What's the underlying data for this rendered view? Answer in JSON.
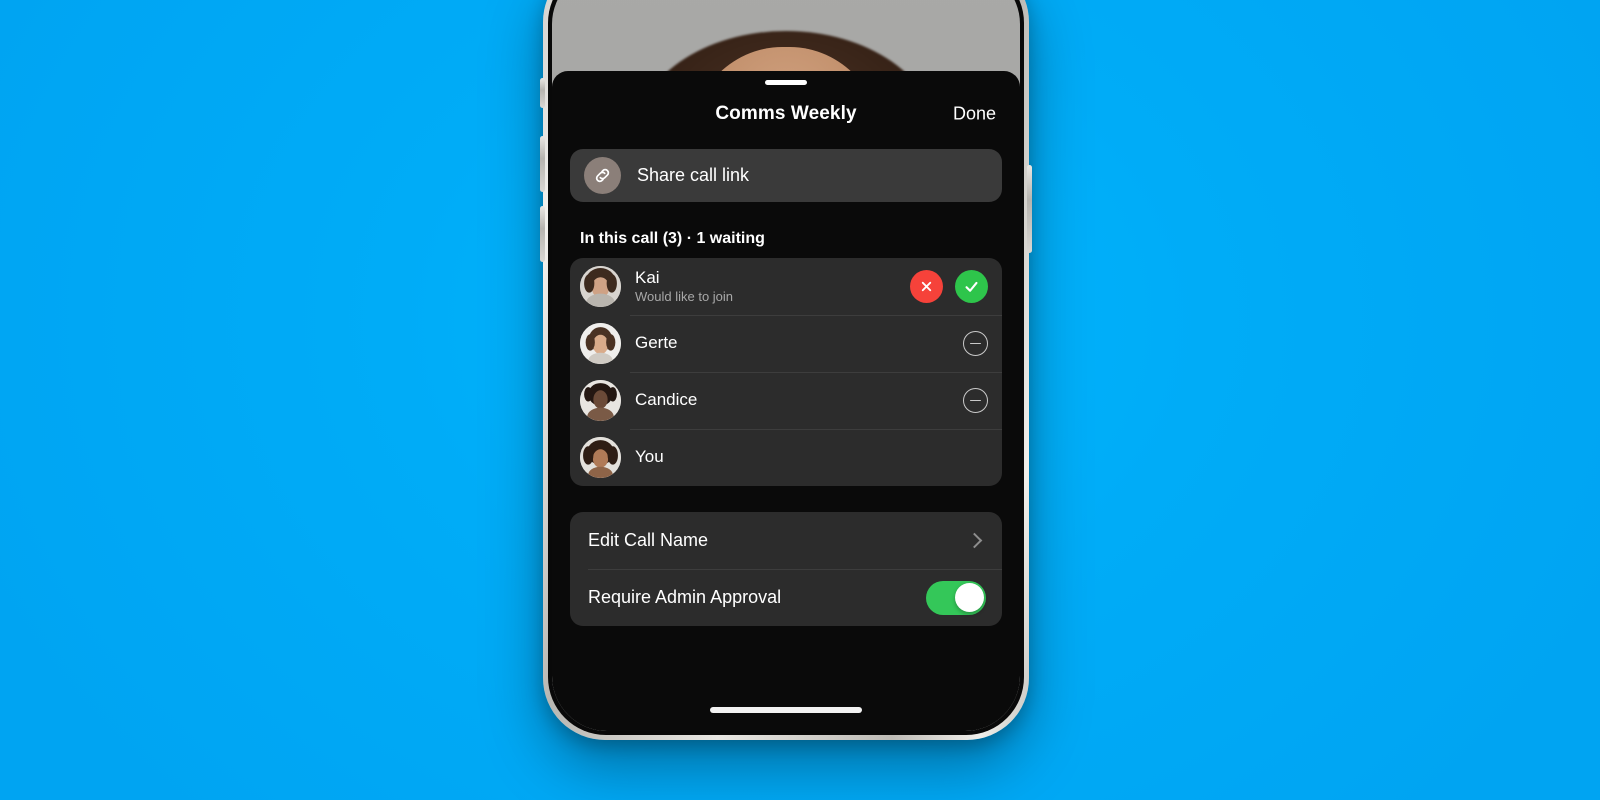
{
  "background": {
    "color": "#00acf7"
  },
  "device": {
    "frame_color": "#cfcdc9",
    "home_indicator": true
  },
  "video": {
    "description": "video-call-feed"
  },
  "sheet": {
    "grabber": true,
    "title": "Comms Weekly",
    "done_label": "Done",
    "share": {
      "label": "Share call link",
      "icon": "link-icon"
    },
    "section_header": "In this call (3) · 1 waiting",
    "participants": [
      {
        "name": "Kai",
        "subtitle": "Would like to join",
        "state": "waiting",
        "actions": [
          "decline",
          "accept"
        ],
        "avatar_hair": "#3d2a1e",
        "avatar_skin": "#cfa285",
        "avatar_bg": "#d8d4cf"
      },
      {
        "name": "Gerte",
        "subtitle": "",
        "state": "in-call",
        "actions": [
          "remove"
        ],
        "avatar_hair": "#4a3223",
        "avatar_skin": "#d9ab8a",
        "avatar_bg": "#efeeec"
      },
      {
        "name": "Candice",
        "subtitle": "",
        "state": "in-call",
        "actions": [
          "remove"
        ],
        "avatar_hair": "#241712",
        "avatar_skin": "#6b4a38",
        "avatar_bg": "#e8e5e1"
      },
      {
        "name": "You",
        "subtitle": "",
        "state": "self",
        "actions": [],
        "avatar_hair": "#2e1d14",
        "avatar_skin": "#b07a57",
        "avatar_bg": "#e3e0db"
      }
    ],
    "settings": [
      {
        "label": "Edit Call Name",
        "control": "chevron"
      },
      {
        "label": "Require Admin Approval",
        "control": "toggle",
        "value": true
      }
    ]
  },
  "colors": {
    "accent_green": "#34c759",
    "decline_red": "#f6423a",
    "accept_green": "#2ec54b",
    "sheet_bg": "#0a0a0a",
    "card_bg": "#2c2c2c",
    "share_bg": "#3a3a3a"
  }
}
